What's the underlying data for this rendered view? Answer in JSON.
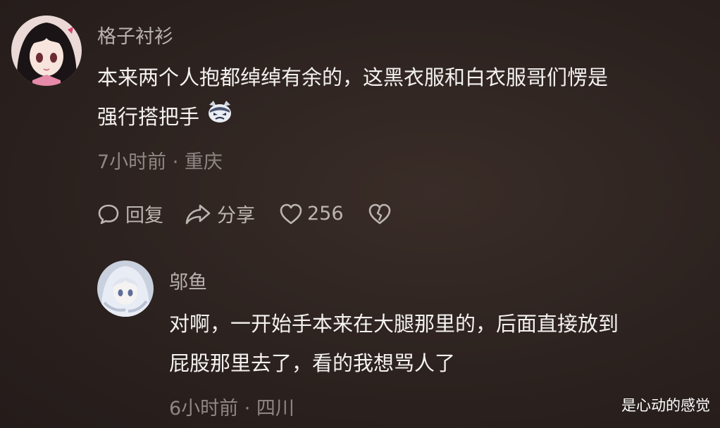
{
  "comment": {
    "username": "格子衬衫",
    "text_line1": "本来两个人抱都绰绰有余的，这黑衣服和白衣服哥们愣是",
    "text_line2": "强行搭把手",
    "emoji_icon": "cat-face-emoji-icon",
    "meta": "7小时前 · 重庆",
    "actions": {
      "reply_label": "回复",
      "share_label": "分享",
      "like_count": "256"
    }
  },
  "reply": {
    "username": "邬鱼",
    "text_line1": "对啊，一开始手本来在大腿那里的，后面直接放到",
    "text_line2": "屁股那里去了，看的我想骂人了",
    "meta": "6小时前 · 四川"
  },
  "watermark": "是心动的感觉",
  "colors": {
    "background": "#2e2420",
    "text_primary": "#f4f2f1",
    "text_secondary": "#b9b3b0",
    "text_meta": "#8f8784"
  }
}
